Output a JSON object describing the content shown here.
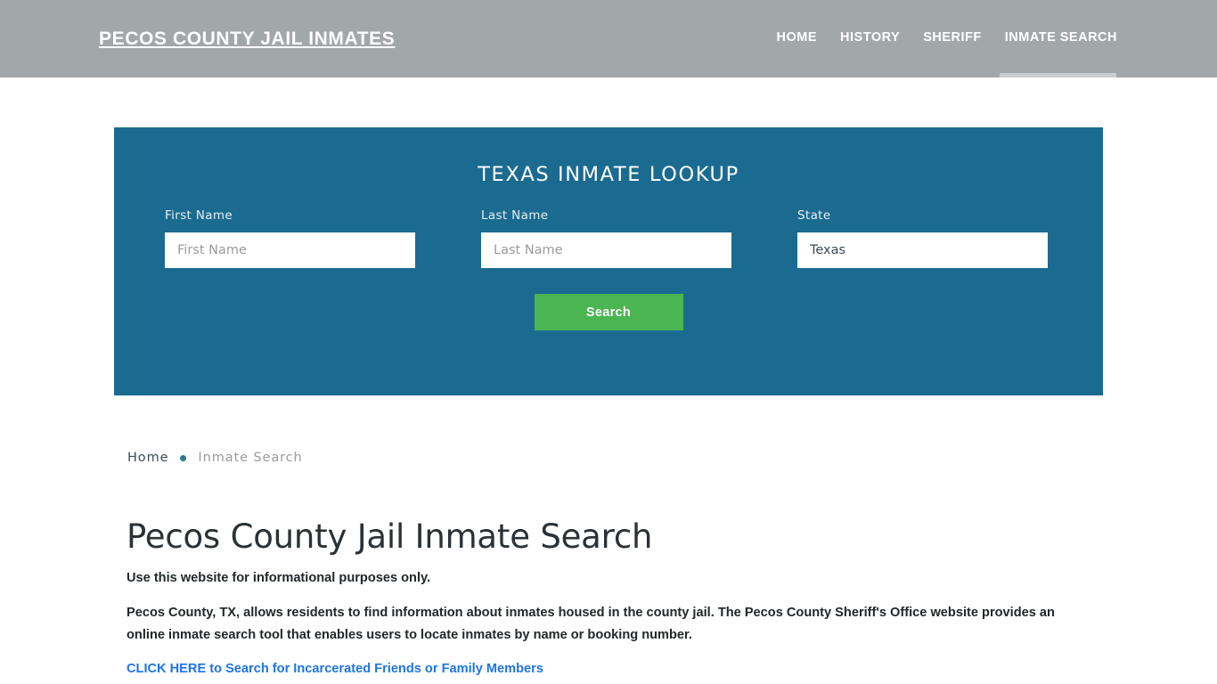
{
  "header": {
    "brand": "PECOS COUNTY JAIL INMATES",
    "background_color": "#a2a7aa",
    "nav": [
      {
        "label": "HOME",
        "active": false
      },
      {
        "label": "HISTORY",
        "active": false
      },
      {
        "label": "SHERIFF",
        "active": false
      },
      {
        "label": "INMATE SEARCH",
        "active": true
      }
    ]
  },
  "lookup": {
    "title": "TEXAS INMATE LOOKUP",
    "panel_color": "#1b6b91",
    "fields": {
      "first_name": {
        "label": "First Name",
        "placeholder": "First Name",
        "value": ""
      },
      "last_name": {
        "label": "Last Name",
        "placeholder": "Last Name",
        "value": ""
      },
      "state": {
        "label": "State",
        "value": "Texas",
        "options": [
          "Texas"
        ]
      }
    },
    "search_button": {
      "label": "Search",
      "color": "#4bb552"
    }
  },
  "breadcrumb": {
    "home": "Home",
    "separator": "•",
    "current": "Inmate Search"
  },
  "main": {
    "title": "Pecos County Jail Inmate Search",
    "paragraph_1": "Use this website for informational purposes only.",
    "paragraph_2": "Pecos County, TX, allows residents to find information about inmates housed in the county jail. The Pecos County Sheriff's Office website provides an online inmate search tool that enables users to locate inmates by name or booking number.",
    "cta_link": "CLICK HERE to Search for Incarcerated Friends or Family Members",
    "link_color": "#1e74e8"
  }
}
